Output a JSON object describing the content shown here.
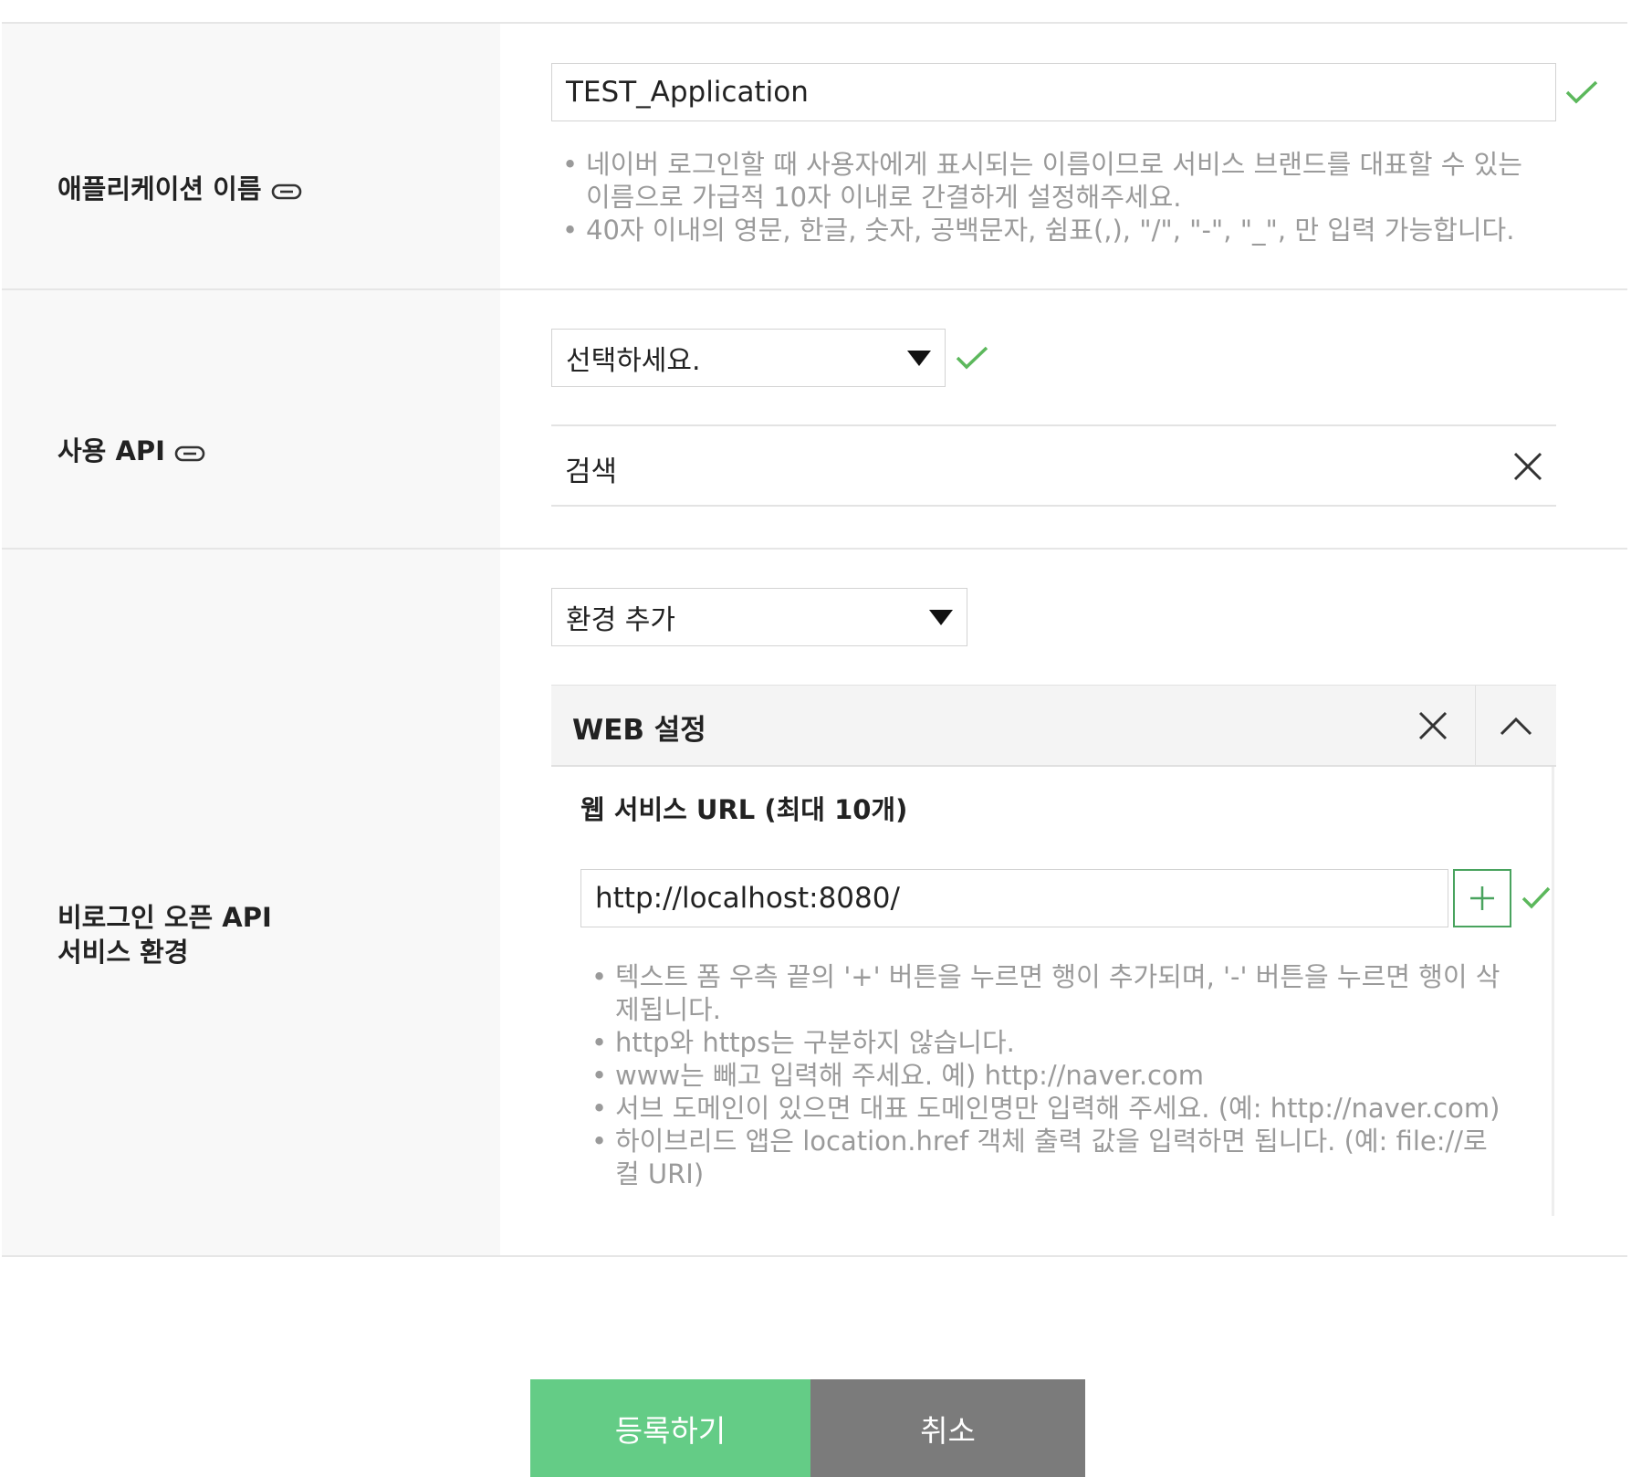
{
  "app_name": {
    "label": "애플리케이션 이름",
    "value": "TEST_Application",
    "help": [
      "네이버 로그인할 때 사용자에게 표시되는 이름이므로 서비스 브랜드를 대표할 수 있는 이름으로 가급적 10자 이내로 간결하게 설정해주세요.",
      "40자 이내의 영문, 한글, 숫자, 공백문자, 쉼표(,), \"/\", \"-\", \"_\", 만 입력 가능합니다."
    ]
  },
  "api": {
    "label": "사용 API",
    "select_value": "선택하세요.",
    "selected_items": [
      "검색"
    ]
  },
  "env": {
    "label": "비로그인 오픈 API\n서비스 환경",
    "add_select": "환경 추가",
    "panel_title": "WEB 설정",
    "url_heading": "웹 서비스 URL (최대 10개)",
    "url_value": "http://localhost:8080/",
    "add_button": "+",
    "help": [
      "텍스트 폼 우측 끝의 '+' 버튼을 누르면 행이 추가되며, '-' 버튼을 누르면 행이 삭제됩니다.",
      "http와 https는 구분하지 않습니다.",
      "www는 빼고 입력해 주세요. 예) http://naver.com",
      "서브 도메인이 있으면 대표 도메인명만 입력해 주세요. (예: http://naver.com)",
      "하이브리드 앱은 location.href 객체 출력 값을 입력하면 됩니다. (예: file://로컬 URI)"
    ]
  },
  "buttons": {
    "register": "등록하기",
    "cancel": "취소"
  },
  "colors": {
    "check": "#5cb85c",
    "primary": "#64cc86",
    "secondary": "#7b7b7b",
    "add_border": "#49a35e"
  }
}
